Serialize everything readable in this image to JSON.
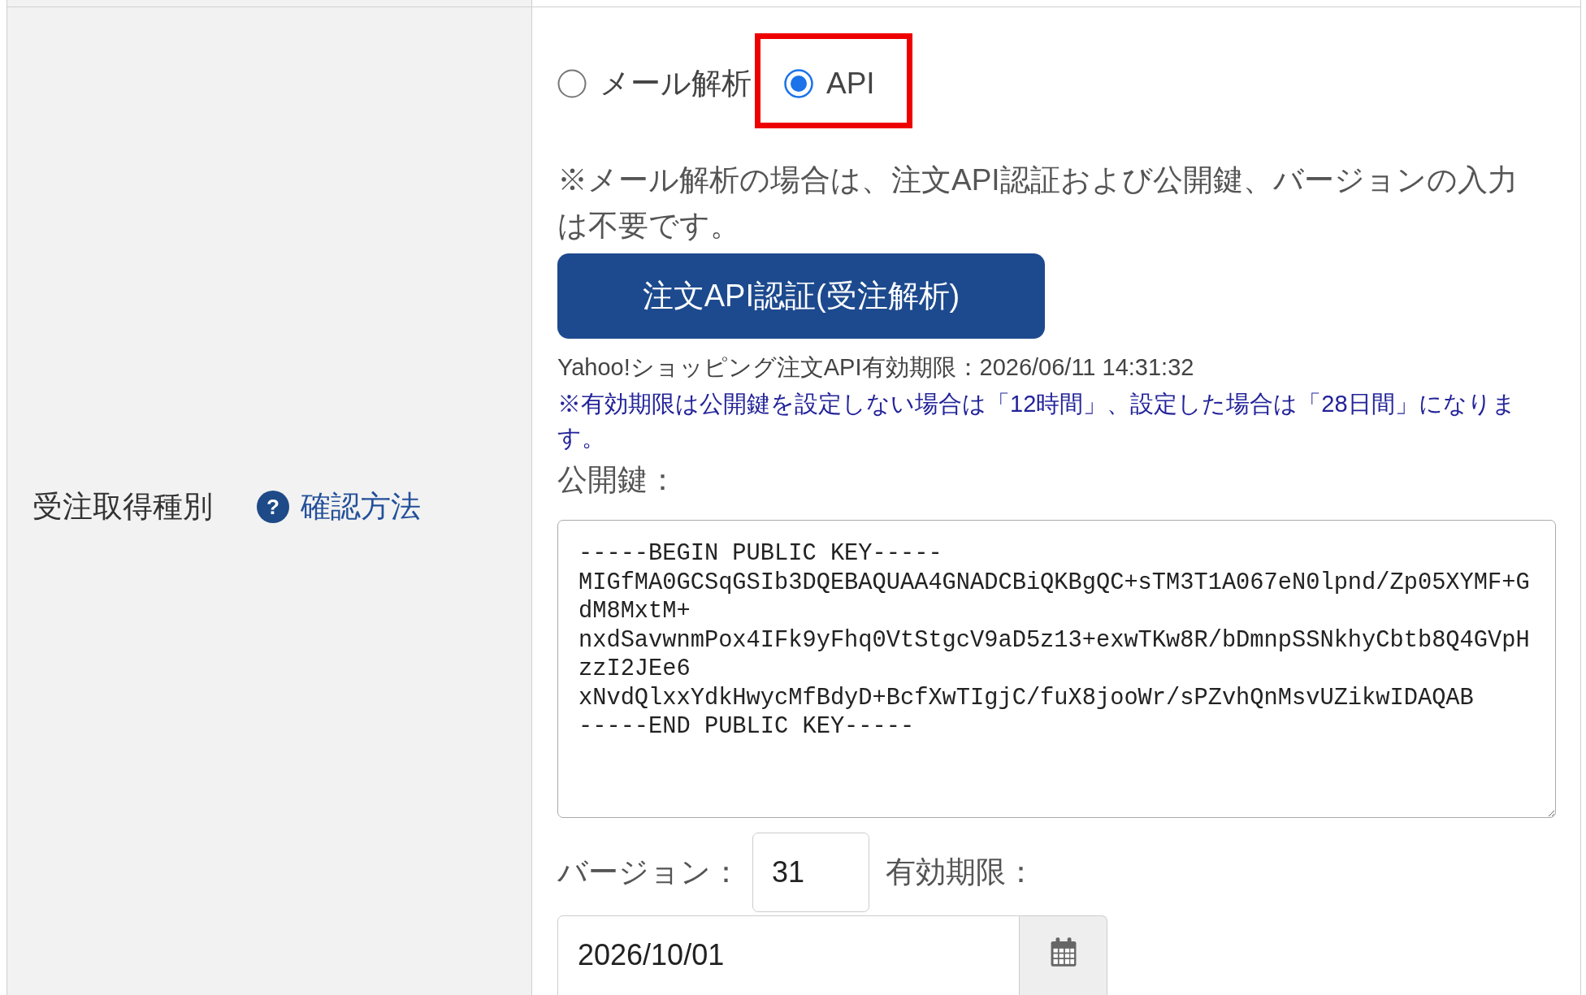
{
  "form_row": {
    "label": "受注取得種別",
    "help_icon": "?",
    "help_link": "確認方法"
  },
  "order_source": {
    "options": [
      {
        "label": "メール解析",
        "selected": false,
        "highlighted": false
      },
      {
        "label": "API",
        "selected": true,
        "highlighted": true
      }
    ],
    "note": "※メール解析の場合は、注文API認証および公開鍵、バージョンの入力は不要です。",
    "auth_button": "注文API認証(受注解析)",
    "api_expiry": "Yahoo!ショッピング注文API有効期限：2026/06/11 14:31:32",
    "expiry_note": "※有効期限は公開鍵を設定しない場合は「12時間」、設定した場合は「28日間」になります。",
    "public_key": {
      "label": "公開鍵：",
      "lines": [
        "-----BEGIN PUBLIC KEY-----",
        "MIGfMA0GCSqGSIb3DQEBAQUAA4GNADCBiQKBgQC+sTM3T1A067eN0lpnd/Zp05XYMF+G",
        "dM8MxtM+",
        "nxdSavwnmPox4IFk9yFhq0VtStgcV9aD5z13+exwTKw8R/bDmnpSSNkhyCbtb8Q4GVpH",
        "zzI2JEe6",
        "xNvdQlxxYdkHwycMfBdyD+BcfXwTIgjC/fuX8jooWr/sPZvhQnMsvUZikwIDAQAB",
        "-----END PUBLIC KEY-----"
      ]
    },
    "version": {
      "label": "バージョン：",
      "value": "31"
    },
    "expiry_date": {
      "label": "有効期限：",
      "value": "2026/10/01"
    }
  }
}
